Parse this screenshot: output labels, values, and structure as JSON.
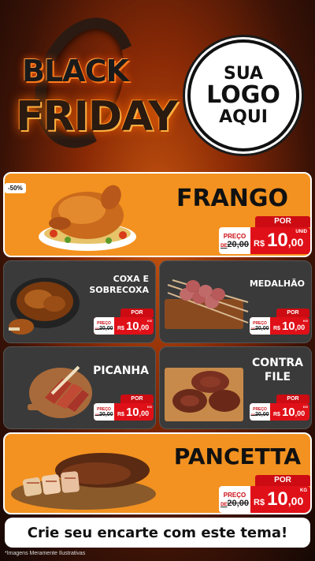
{
  "header": {
    "black": "BLACK",
    "friday": "FRIDAY",
    "logo_l1": "SUA",
    "logo_l2": "LOGO",
    "logo_l3": "AQUI"
  },
  "discount_badge": "-50%",
  "items": [
    {
      "name": "FRANGO",
      "por": "POR",
      "preco": "PREÇO",
      "de": "DE",
      "old": "20,00",
      "currency": "R$",
      "new_int": "10",
      "new_dec": ",00",
      "unit": "UNID"
    },
    {
      "name_l1": "COXA E",
      "name_l2": "SOBRECOXA",
      "por": "POR",
      "preco": "PREÇO",
      "de": "DE",
      "old": "20,00",
      "currency": "R$",
      "new_int": "10",
      "new_dec": ",00",
      "unit": "KG"
    },
    {
      "name": "MEDALHÃO",
      "por": "POR",
      "preco": "PREÇO",
      "de": "DE",
      "old": "20,00",
      "currency": "R$",
      "new_int": "10",
      "new_dec": ",00",
      "unit": "KG"
    },
    {
      "name": "PICANHA",
      "por": "POR",
      "preco": "PREÇO",
      "de": "DE",
      "old": "20,00",
      "currency": "R$",
      "new_int": "10",
      "new_dec": ",00",
      "unit": "KG"
    },
    {
      "name_l1": "CONTRA",
      "name_l2": "FILE",
      "por": "POR",
      "preco": "PREÇO",
      "de": "DE",
      "old": "20,00",
      "currency": "R$",
      "new_int": "10",
      "new_dec": ",00",
      "unit": "KG"
    },
    {
      "name": "PANCETTA",
      "por": "POR",
      "preco": "PREÇO",
      "de": "DE",
      "old": "20,00",
      "currency": "R$",
      "new_int": "10",
      "new_dec": ",00",
      "unit": "KG"
    }
  ],
  "cta": "Crie seu encarte com este tema!",
  "footnote": "*Imagens Meramente Ilustrativas"
}
